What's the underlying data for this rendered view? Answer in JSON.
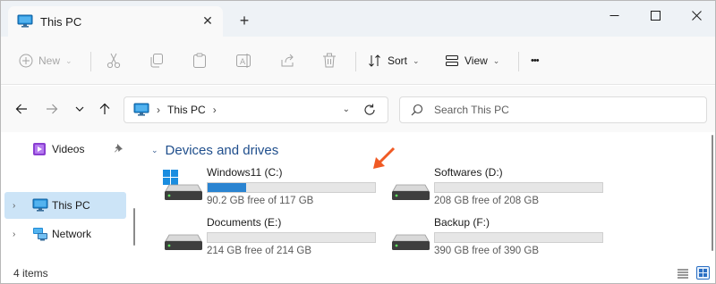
{
  "tab": {
    "title": "This PC",
    "close_glyph": "✕",
    "new_tab_glyph": "+"
  },
  "commands": {
    "new_label": "New",
    "sort_label": "Sort",
    "view_label": "View",
    "more_glyph": "•••",
    "chevron_glyph": "⌄"
  },
  "address": {
    "separator": "›",
    "location": "This PC",
    "dropdown_glyph": "⌄"
  },
  "search": {
    "placeholder": "Search This PC"
  },
  "sidebar": {
    "items": [
      {
        "label": "Videos",
        "icon": "videos-folder-icon",
        "pinned": true
      },
      {
        "label": "This PC",
        "icon": "this-pc-icon",
        "selected": true
      },
      {
        "label": "Network",
        "icon": "network-icon"
      }
    ],
    "expand_glyph": "›",
    "pin_glyph": "📌"
  },
  "content": {
    "group_title": "Devices and drives",
    "group_chevron": "⌄",
    "drives": [
      {
        "name": "Windows11 (C:)",
        "free_text": "90.2 GB free of 117 GB",
        "used_fraction": 0.23,
        "icon": "system-drive-icon"
      },
      {
        "name": "Softwares (D:)",
        "free_text": "208 GB free of 208 GB",
        "used_fraction": 0.0,
        "icon": "drive-icon"
      },
      {
        "name": "Documents (E:)",
        "free_text": "214 GB free of 214 GB",
        "used_fraction": 0.0,
        "icon": "drive-icon"
      },
      {
        "name": "Backup (F:)",
        "free_text": "390 GB free of 390 GB",
        "used_fraction": 0.0,
        "icon": "drive-icon"
      }
    ],
    "annotation_arrow_color": "#f05a24"
  },
  "status": {
    "item_count": "4 items"
  },
  "colors": {
    "accent": "#2a84d1",
    "selection": "#cce4f7",
    "group_title": "#1f4e8c"
  }
}
